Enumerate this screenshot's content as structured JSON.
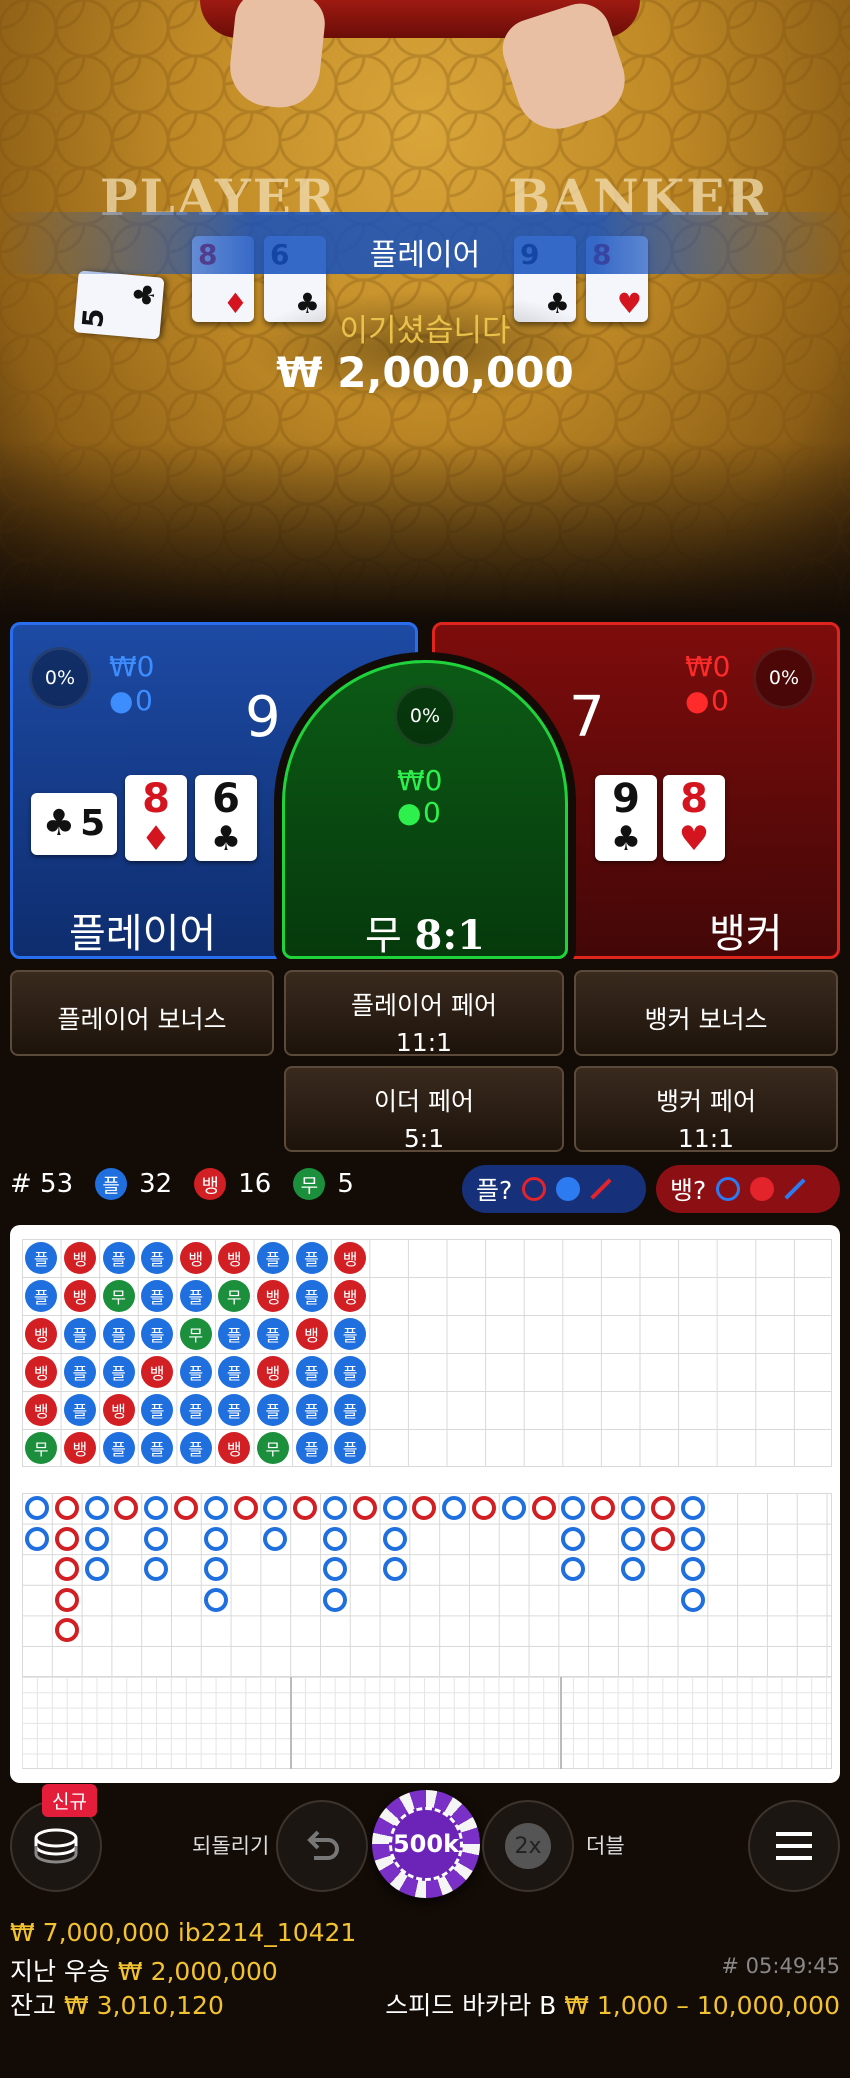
{
  "video": {
    "table_left": "PLAYER",
    "table_right": "BANKER",
    "player_cards": [
      {
        "rank": "5",
        "suit": "♣",
        "color": "black"
      },
      {
        "rank": "8",
        "suit": "♦",
        "color": "red"
      },
      {
        "rank": "6",
        "suit": "♣",
        "color": "black"
      }
    ],
    "banker_cards": [
      {
        "rank": "9",
        "suit": "♣",
        "color": "black"
      },
      {
        "rank": "8",
        "suit": "♥",
        "color": "red"
      }
    ],
    "win_title": "플레이어",
    "win_message": "이기셨습니다",
    "win_amount": "₩ 2,000,000"
  },
  "bets": {
    "player": {
      "label": "플레이어",
      "pct": "0%",
      "amount": "₩0",
      "count": "0",
      "score": "9",
      "cards": [
        {
          "rank": "5",
          "suit": "♣",
          "color": "black"
        },
        {
          "rank": "8",
          "suit": "♦",
          "color": "red"
        },
        {
          "rank": "6",
          "suit": "♣",
          "color": "black"
        }
      ]
    },
    "tie": {
      "label": "무",
      "ratio": "8:1",
      "pct": "0%",
      "amount": "₩0",
      "count": "0"
    },
    "banker": {
      "label": "뱅커",
      "pct": "0%",
      "amount": "₩0",
      "count": "0",
      "score": "7",
      "cards": [
        {
          "rank": "9",
          "suit": "♣",
          "color": "black"
        },
        {
          "rank": "8",
          "suit": "♥",
          "color": "red"
        }
      ]
    }
  },
  "side_bets": {
    "player_bonus": "플레이어 보너스",
    "player_pair": {
      "label": "플레이어 페어",
      "ratio": "11:1"
    },
    "banker_bonus": "뱅커 보너스",
    "either_pair": {
      "label": "이더 페어",
      "ratio": "5:1"
    },
    "banker_pair": {
      "label": "뱅커 페어",
      "ratio": "11:1"
    }
  },
  "stats": {
    "round": "# 53",
    "player_glyph": "플",
    "player_count": "32",
    "banker_glyph": "뱅",
    "banker_count": "16",
    "tie_glyph": "무",
    "tie_count": "5",
    "player_ask": "플?",
    "banker_ask": "뱅?"
  },
  "colors": {
    "player": "#1f6fde",
    "banker": "#d11f24",
    "tie": "#1b8f3b",
    "gold": "#f2c230"
  },
  "bead_road": [
    [
      "플",
      "플",
      "뱅",
      "뱅",
      "뱅",
      "무"
    ],
    [
      "뱅",
      "뱅",
      "플",
      "플",
      "플",
      "뱅"
    ],
    [
      "플",
      "무",
      "플",
      "플",
      "뱅",
      "플"
    ],
    [
      "플",
      "플",
      "플",
      "뱅",
      "플",
      "플"
    ],
    [
      "뱅",
      "플",
      "무",
      "플",
      "플",
      "플"
    ],
    [
      "뱅",
      "무",
      "플",
      "플",
      "플",
      "뱅"
    ],
    [
      "플",
      "뱅",
      "플",
      "뱅",
      "플",
      "무"
    ],
    [
      "플",
      "플",
      "뱅",
      "플",
      "플",
      "플"
    ],
    [
      "뱅",
      "뱅",
      "플",
      "플",
      "플",
      "플"
    ]
  ],
  "controls": {
    "new_badge": "신규",
    "undo_label": "되돌리기",
    "chip_value": "500k",
    "double_icon_text": "2x",
    "double_label": "더블",
    "menu_icon": "hamburger-menu-icon"
  },
  "footer": {
    "bet_and_user": "₩ 7,000,000 ib2214_10421",
    "last_win_label": "지난 우승",
    "last_win_amount": "₩ 2,000,000",
    "balance_label": "잔고",
    "balance_amount": "₩ 3,010,120",
    "round_id": "# 05:49:45",
    "table_name": "스피드 바카라 B",
    "limits": "₩ 1,000 – 10,000,000"
  }
}
